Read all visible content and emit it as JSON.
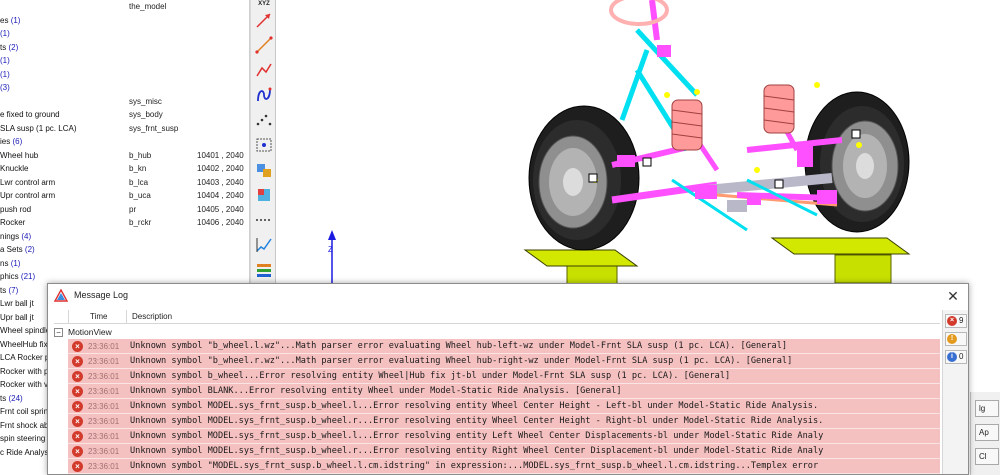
{
  "browser": {
    "rows": [
      {
        "name": "",
        "var": "the_model",
        "id": ""
      },
      {
        "name": "es",
        "count": "(1)",
        "var": "",
        "id": ""
      },
      {
        "name": "",
        "count": "(1)",
        "var": "",
        "id": ""
      },
      {
        "name": "ts",
        "count": "(2)",
        "var": "",
        "id": ""
      },
      {
        "name": "",
        "count": "(1)",
        "var": "",
        "id": ""
      },
      {
        "name": "",
        "count": "(1)",
        "var": "",
        "id": ""
      },
      {
        "name": "",
        "count": "(3)",
        "var": "",
        "id": ""
      },
      {
        "name": "",
        "var": "sys_misc",
        "id": ""
      },
      {
        "name": "e fixed to ground",
        "var": "sys_body",
        "id": ""
      },
      {
        "name": "SLA susp (1 pc. LCA)",
        "var": "sys_frnt_susp",
        "id": ""
      },
      {
        "name": "ies",
        "count": "(6)",
        "var": "",
        "id": ""
      },
      {
        "name": "Wheel hub",
        "var": "b_hub",
        "id": "10401 , 2040"
      },
      {
        "name": "Knuckle",
        "var": "b_kn",
        "id": "10402 , 2040"
      },
      {
        "name": "Lwr control arm",
        "var": "b_lca",
        "id": "10403 , 2040"
      },
      {
        "name": "Upr control arm",
        "var": "b_uca",
        "id": "10404 , 2040"
      },
      {
        "name": "push rod",
        "var": "pr",
        "id": "10405 , 2040"
      },
      {
        "name": "Rocker",
        "var": "b_rckr",
        "id": "10406 , 2040"
      },
      {
        "name": "nings",
        "count": "(4)",
        "var": "",
        "id": ""
      },
      {
        "name": "a Sets",
        "count": "(2)",
        "var": "",
        "id": ""
      },
      {
        "name": "ns",
        "count": "(1)",
        "var": "",
        "id": ""
      },
      {
        "name": "phics",
        "count": "(21)",
        "var": "",
        "id": ""
      },
      {
        "name": "ts",
        "count": "(7)",
        "var": "",
        "id": ""
      },
      {
        "name": "Lwr ball jt",
        "var": "",
        "id": ""
      },
      {
        "name": "Upr ball jt",
        "var": "",
        "id": ""
      },
      {
        "name": "Wheel spindle",
        "var": "",
        "id": ""
      },
      {
        "name": "WheelHub fix",
        "var": "",
        "id": ""
      },
      {
        "name": "LCA Rocker p",
        "var": "",
        "id": ""
      },
      {
        "name": "Rocker with p",
        "var": "",
        "id": ""
      },
      {
        "name": "Rocker with v",
        "var": "",
        "id": ""
      },
      {
        "name": "ts",
        "count": "(24)",
        "var": "",
        "id": ""
      },
      {
        "name": "Frnt coil spring",
        "var": "",
        "id": ""
      },
      {
        "name": "Frnt shock abs",
        "var": "",
        "id": ""
      },
      {
        "name": "spin steering",
        "var": "",
        "id": ""
      },
      {
        "name": "c Ride Analys",
        "var": "",
        "id": ""
      }
    ]
  },
  "toolbar": {
    "xyz_label": "XYZ",
    "tools": [
      "arrow-marker-icon",
      "line-marker-icon",
      "polyline-icon",
      "spring-icon",
      "joint-dots-icon",
      "point-move-icon",
      "body-icon",
      "contour-icon",
      "dotted-line-icon",
      "graph-icon",
      "stack-icon",
      "assembly-icon"
    ]
  },
  "viewport": {
    "axis_label": "Z"
  },
  "message_log": {
    "title": "Message Log",
    "close": "✕",
    "col_time": "Time",
    "col_description": "Description",
    "group": "MotionView",
    "group_toggle": "−",
    "rows": [
      {
        "time": "23:36:01",
        "text": "Unknown symbol \"b_wheel.l.wz\"...Math parser error evaluating Wheel hub-left-wz under Model-Frnt SLA susp (1 pc. LCA). [General]"
      },
      {
        "time": "23:36:01",
        "text": "Unknown symbol \"b_wheel.r.wz\"...Math parser error evaluating Wheel hub-right-wz under Model-Frnt SLA susp (1 pc. LCA). [General]"
      },
      {
        "time": "23:36:01",
        "text": "Unknown symbol b_wheel...Error resolving entity Wheel|Hub fix jt-bl under Model-Frnt SLA susp (1 pc. LCA). [General]"
      },
      {
        "time": "23:36:01",
        "text": "Unknown symbol BLANK...Error resolving entity Wheel under Model-Static Ride Analysis. [General]"
      },
      {
        "time": "23:36:01",
        "text": "Unknown symbol MODEL.sys_frnt_susp.b_wheel.l...Error resolving entity Wheel Center Height - Left-bl under Model-Static Ride Analysis."
      },
      {
        "time": "23:36:01",
        "text": "Unknown symbol MODEL.sys_frnt_susp.b_wheel.r...Error resolving entity Wheel Center Height - Right-bl under Model-Static Ride Analysis."
      },
      {
        "time": "23:36:01",
        "text": "Unknown symbol MODEL.sys_frnt_susp.b_wheel.l...Error resolving entity Left Wheel Center Displacements-bl under Model-Static Ride Analy"
      },
      {
        "time": "23:36:01",
        "text": "Unknown symbol MODEL.sys_frnt_susp.b_wheel.r...Error resolving entity Right Wheel Center Displacement-bl under Model-Static Ride Analy"
      },
      {
        "time": "23:36:01",
        "text": "Unknown symbol \"MODEL.sys_frnt_susp.b_wheel.l.cm.idstring\" in expression:...MODEL.sys_frnt_susp.b_wheel.l.cm.idstring...Templex error"
      }
    ],
    "filters": [
      {
        "kind": "error",
        "count": "9",
        "color": "#d23a2c",
        "glyph": "×"
      },
      {
        "kind": "warning",
        "count": "",
        "color": "#e39a1e",
        "glyph": "!"
      },
      {
        "kind": "info",
        "count": "0",
        "color": "#3a6fd2",
        "glyph": "i"
      }
    ]
  },
  "background_dialog": {
    "buttons": [
      "lg",
      "Ap",
      "Cl"
    ]
  }
}
